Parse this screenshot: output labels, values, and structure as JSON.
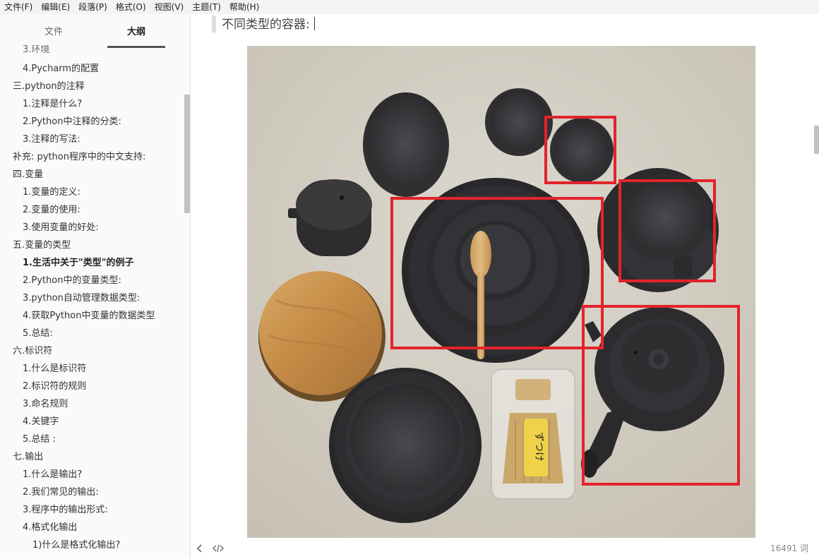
{
  "menubar": {
    "items": [
      "文件(F)",
      "编辑(E)",
      "段落(P)",
      "格式(O)",
      "视图(V)",
      "主题(T)",
      "帮助(H)"
    ]
  },
  "sidebar": {
    "tabs": {
      "files": "文件",
      "outline": "大纲"
    },
    "clipped_item": "3.环境",
    "items": [
      {
        "label": "4.Pycharm的配置",
        "level": 2
      },
      {
        "label": "三.python的注释",
        "level": 1
      },
      {
        "label": "1.注释是什么?",
        "level": 2
      },
      {
        "label": "2.Python中注释的分类:",
        "level": 2
      },
      {
        "label": "3.注释的写法:",
        "level": 2
      },
      {
        "label": "补充: python程序中的中文支持:",
        "level": 1
      },
      {
        "label": "四.变量",
        "level": 1
      },
      {
        "label": "1.变量的定义:",
        "level": 2
      },
      {
        "label": "2.变量的使用:",
        "level": 2
      },
      {
        "label": "3.使用变量的好处:",
        "level": 2
      },
      {
        "label": "五.变量的类型",
        "level": 1
      },
      {
        "label": "1.生活中关于\"类型\"的例子",
        "level": 2,
        "active": true
      },
      {
        "label": "2.Python中的变量类型:",
        "level": 2
      },
      {
        "label": "3.python自动管理数据类型:",
        "level": 2
      },
      {
        "label": "4.获取Python中变量的数据类型",
        "level": 2
      },
      {
        "label": "5.总结:",
        "level": 2
      },
      {
        "label": "六.标识符",
        "level": 1
      },
      {
        "label": "1.什么是标识符",
        "level": 2
      },
      {
        "label": "2.标识符的规则",
        "level": 2
      },
      {
        "label": "3.命名规则",
        "level": 2
      },
      {
        "label": "4.关键字",
        "level": 2
      },
      {
        "label": "5.总结 :",
        "level": 2
      },
      {
        "label": "七.输出",
        "level": 1
      },
      {
        "label": "1.什么是输出?",
        "level": 2
      },
      {
        "label": "2.我们常见的输出:",
        "level": 2
      },
      {
        "label": "3.程序中的输出形式:",
        "level": 2
      },
      {
        "label": "4.格式化输出",
        "level": 2
      },
      {
        "label": "1)什么是格式化输出?",
        "level": 3
      }
    ]
  },
  "editor": {
    "paragraph_text": "不同类型的容器:",
    "photo_label": "tableware-photo",
    "box_label_text": "ずつけ"
  },
  "statusbar": {
    "word_count": "16491 词",
    "prev_icon": "chevron-left-icon",
    "source_icon": "code-icon"
  },
  "colors": {
    "highlight_box": "#e3232a",
    "tableware": "#2e2e31",
    "table_cloth": "#d4cfc4",
    "wood_lid": "#c8924f"
  }
}
